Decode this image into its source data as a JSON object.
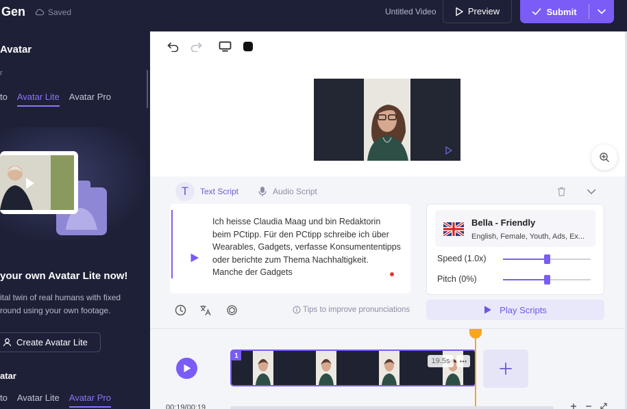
{
  "header": {
    "brand": "Gen",
    "saved_status": "Saved",
    "document_title": "Untitled Video",
    "preview_label": "Preview",
    "submit_label": "Submit"
  },
  "sidebar": {
    "title": "Avatar",
    "mini_label": "r",
    "tabs": [
      {
        "label": "to",
        "active": false
      },
      {
        "label": "Avatar Lite",
        "active": true
      },
      {
        "label": "Avatar Pro",
        "active": false
      }
    ],
    "promo_title": "your own Avatar Lite now!",
    "promo_description": "ital twin of real humans with fixed round using your own footage.",
    "create_button_label": "Create Avatar Lite",
    "section2_title": "atar",
    "tabs2": [
      {
        "label": "to",
        "active": false
      },
      {
        "label": "Avatar Lite",
        "active": false
      },
      {
        "label": "Avatar Pro",
        "active": true
      }
    ]
  },
  "script_panel": {
    "text_tab": "Text Script",
    "audio_tab": "Audio Script",
    "text_badge": "T",
    "script_text": "Ich heisse Claudia Maag und bin Redaktorin beim PCtipp. Für den PCtipp schreibe ich über Wearables, Gadgets, verfasse Konsumententipps oder berichte zum Thema Nachhaltigkeit. Manche der Gadgets",
    "tips_text": "Tips to improve pronunciations",
    "voice": {
      "name": "Bella - Friendly",
      "description": "English, Female, Youth, Ads, Ex..."
    },
    "speed": {
      "label": "Speed (1.0x)",
      "value": 0.5
    },
    "pitch": {
      "label": "Pitch (0%)",
      "value": 0.5
    },
    "play_scripts_label": "Play Scripts"
  },
  "timeline": {
    "clip_number": "1",
    "clip_duration": "19.5s",
    "time_display": "00:19/00:19"
  },
  "colors": {
    "accent": "#7b5cf6",
    "dark": "#1d2036",
    "playhead": "#f5a623"
  }
}
